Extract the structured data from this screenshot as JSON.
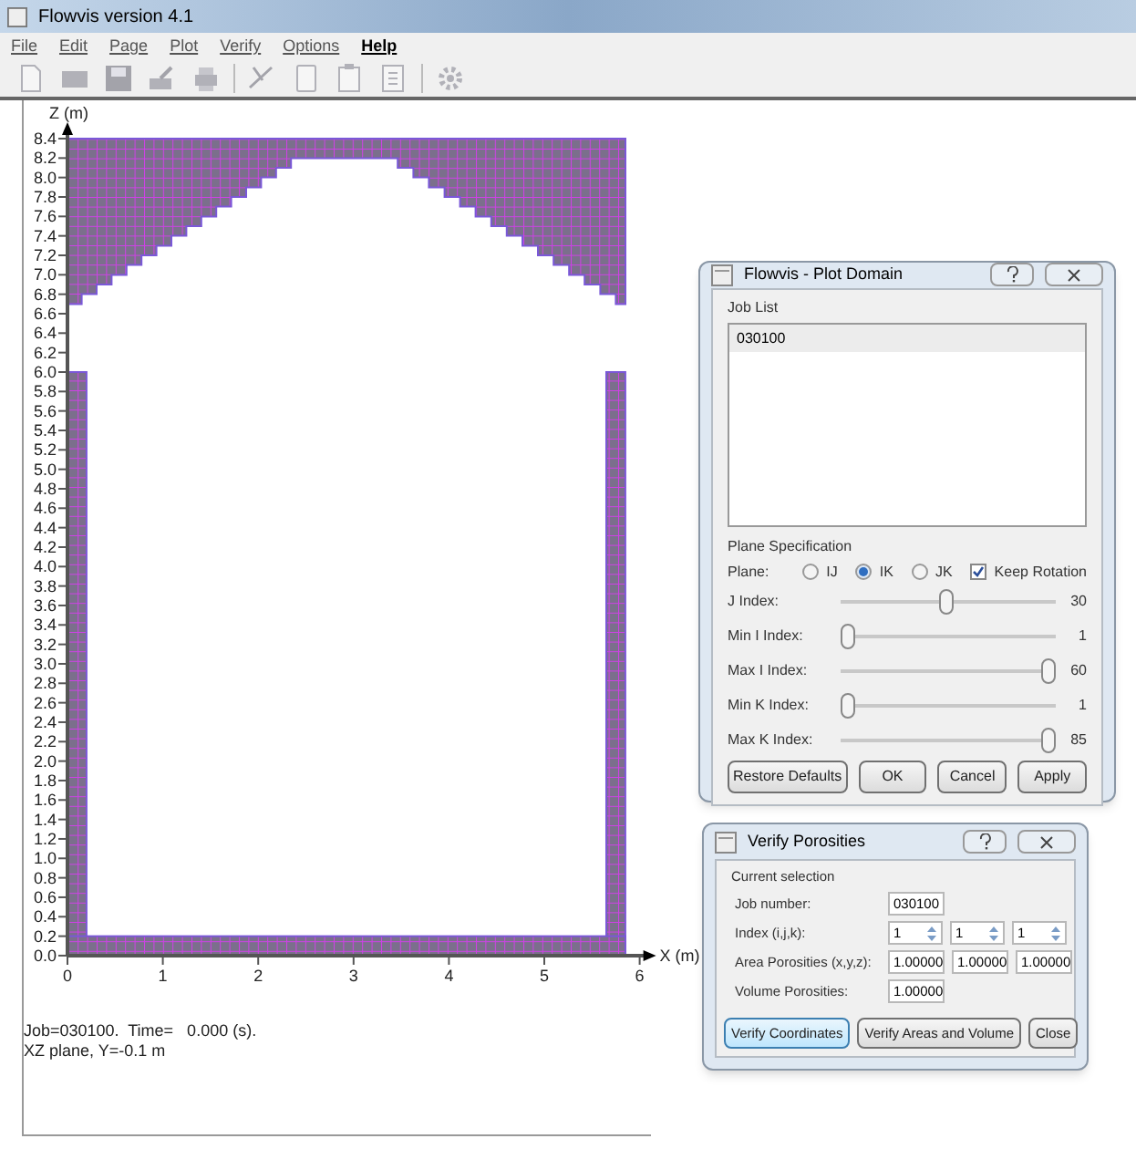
{
  "window": {
    "title": "Flowvis version 4.1"
  },
  "menu": [
    {
      "label": "File",
      "bold": false
    },
    {
      "label": "Edit",
      "bold": false
    },
    {
      "label": "Page",
      "bold": false
    },
    {
      "label": "Plot",
      "bold": false
    },
    {
      "label": "Verify",
      "bold": false
    },
    {
      "label": "Options",
      "bold": false
    },
    {
      "label": "Help",
      "bold": true
    }
  ],
  "plot": {
    "z_axis_label": "Z (m)",
    "x_axis_label": "X (m)",
    "z_ticks": [
      "8.4",
      "8.2",
      "8.0",
      "7.8",
      "7.6",
      "7.4",
      "7.2",
      "7.0",
      "6.8",
      "6.6",
      "6.4",
      "6.2",
      "6.0",
      "5.8",
      "5.6",
      "5.4",
      "5.2",
      "5.0",
      "4.8",
      "4.6",
      "4.4",
      "4.2",
      "4.0",
      "3.8",
      "3.6",
      "3.4",
      "3.2",
      "3.0",
      "2.8",
      "2.6",
      "2.4",
      "2.2",
      "2.0",
      "1.8",
      "1.6",
      "1.4",
      "1.2",
      "1.0",
      "0.8",
      "0.6",
      "0.4",
      "0.2",
      "0.0"
    ],
    "x_ticks": [
      "0",
      "1",
      "2",
      "3",
      "4",
      "5",
      "6"
    ],
    "info": [
      "Job=030100.  Time=   0.000 (s).",
      "XZ plane, Y=-0.1 m"
    ]
  },
  "plot_domain": {
    "title": "Flowvis - Plot Domain",
    "job_list_label": "Job List",
    "jobs": [
      {
        "label": "030100",
        "selected": true
      }
    ],
    "plane_spec_label": "Plane Specification",
    "plane_label": "Plane:",
    "planes": [
      {
        "label": "IJ",
        "selected": false
      },
      {
        "label": "IK",
        "selected": true
      },
      {
        "label": "JK",
        "selected": false
      }
    ],
    "keep_rotation": {
      "label": "Keep Rotation",
      "checked": true
    },
    "sliders": [
      {
        "label": "J Index:",
        "value": "30",
        "level": 0.49
      },
      {
        "label": "Min I Index:",
        "value": "1",
        "level": 0
      },
      {
        "label": "Max I Index:",
        "value": "60",
        "level": 1
      },
      {
        "label": "Min K Index:",
        "value": "1",
        "level": 0
      },
      {
        "label": "Max K Index:",
        "value": "85",
        "level": 1
      }
    ],
    "buttons": [
      "Restore Defaults",
      "OK",
      "Cancel",
      "Apply"
    ]
  },
  "verify": {
    "title": "Verify Porosities",
    "group_label": "Current selection",
    "job_label": "Job number:",
    "job_value": "030100",
    "index_label": "Index (i,j,k):",
    "index_values": [
      "1",
      "1",
      "1"
    ],
    "area_label": "Area Porosities (x,y,z):",
    "area_values": [
      "1.00000",
      "1.00000",
      "1.00000"
    ],
    "volume_label": "Volume Porosities:",
    "volume_value": "1.00000",
    "buttons": [
      {
        "label": "Verify Coordinates",
        "selected": true
      },
      {
        "label": "Verify Areas and Volume",
        "selected": false
      },
      {
        "label": "Close",
        "selected": false
      }
    ]
  }
}
